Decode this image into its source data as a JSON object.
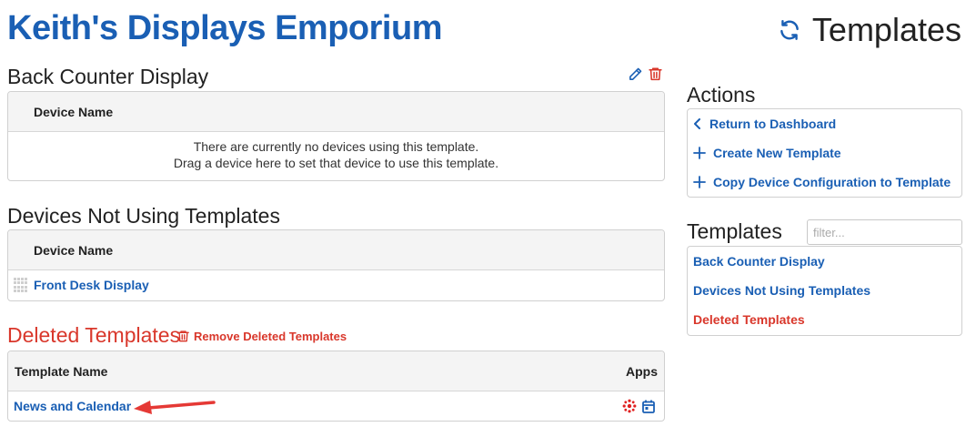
{
  "header": {
    "brand": "Keith's Displays Emporium",
    "page_title": "Templates",
    "refresh_icon": "refresh-icon"
  },
  "back_counter": {
    "title": "Back Counter Display",
    "edit_icon": "pencil-icon",
    "delete_icon": "trash-icon",
    "column_header": "Device Name",
    "empty_line1": "There are currently no devices using this template.",
    "empty_line2": "Drag a device here to set that device to use this template."
  },
  "not_using": {
    "title": "Devices Not Using Templates",
    "column_header": "Device Name",
    "rows": [
      {
        "name": "Front Desk Display"
      }
    ]
  },
  "deleted": {
    "title": "Deleted Templates",
    "remove_label": "Remove Deleted Templates",
    "col_template": "Template Name",
    "col_apps": "Apps",
    "rows": [
      {
        "name": "News and Calendar",
        "apps": [
          "globe-app-icon",
          "calendar-app-icon"
        ]
      }
    ]
  },
  "actions": {
    "title": "Actions",
    "items": [
      {
        "label": "Return to Dashboard",
        "icon": "chevron-left-icon"
      },
      {
        "label": "Create New Template",
        "icon": "plus-icon"
      },
      {
        "label": "Copy Device Configuration to Template",
        "icon": "plus-icon"
      }
    ]
  },
  "templates_nav": {
    "title": "Templates",
    "filter_placeholder": "filter...",
    "items": [
      {
        "label": "Back Counter Display"
      },
      {
        "label": "Devices Not Using Templates"
      },
      {
        "label": "Deleted Templates"
      }
    ]
  },
  "colors": {
    "brand_blue": "#1a5fb4",
    "danger_red": "#d9372b",
    "annotation_arrow": "#e53935"
  }
}
